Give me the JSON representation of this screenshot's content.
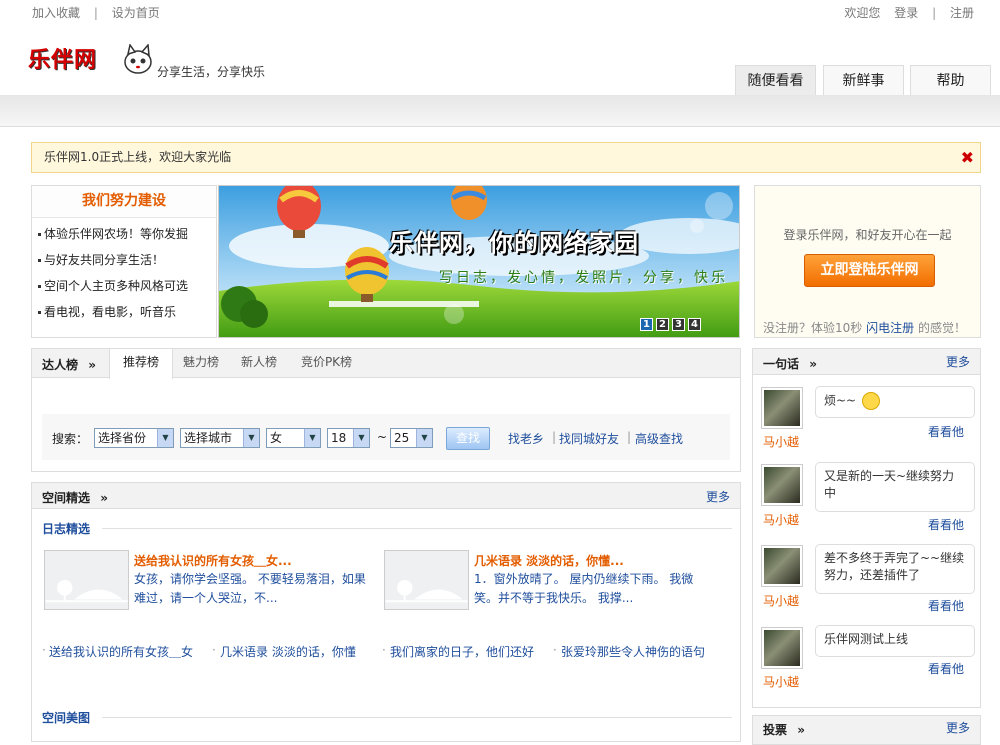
{
  "top": {
    "links": [
      "加入收藏",
      "设为首页"
    ],
    "sep": "|",
    "user_links": [
      "欢迎您",
      "登录",
      "注册"
    ]
  },
  "header": {
    "logo": "乐伴网",
    "slogan": "分享生活，分享快乐",
    "tabs": [
      "随便看看",
      "新鲜事",
      "帮助"
    ]
  },
  "notice": {
    "text": "乐伴网1.0正式上线，欢迎大家光临",
    "close": "✖"
  },
  "build": {
    "title": "我们努力建设",
    "items": [
      "体验乐伴网农场！等你发掘",
      "与好友共同分享生活！",
      "空间个人主页多种风格可选",
      "看电视，看电影，听音乐"
    ]
  },
  "banner": {
    "title": "乐伴网，你的网络家园",
    "subtitle": "写日志，发心情，发照片，分享，快乐",
    "pages": [
      "1",
      "2",
      "3",
      "4"
    ]
  },
  "login": {
    "text": "登录乐伴网，和好友开心在一起",
    "button": "立即登陆乐伴网",
    "reg_prefix": "没注册？体验10秒",
    "reg_link": "闪电注册",
    "reg_suffix": "的感觉！"
  },
  "rank": {
    "title": "达人榜",
    "arrow": "»",
    "tabs": [
      "推荐榜",
      "魅力榜",
      "新人榜",
      "竞价PK榜"
    ],
    "search_label": "搜索：",
    "province": "选择省份",
    "city": "选择城市",
    "gender": "女",
    "age_from": "18",
    "age_to": "25",
    "tilde": "~",
    "search_button": "查找",
    "quick_links": [
      "找老乡",
      "找同城好友",
      "高级查找"
    ]
  },
  "space": {
    "title": "空间精选",
    "arrow": "»",
    "more": "更多",
    "blog_title": "日志精选",
    "posts": [
      {
        "title": "送给我认识的所有女孩＿女...",
        "desc": "女孩，请你学会坚强。  不要轻易落泪，如果难过，请一个人哭泣，不..."
      },
      {
        "title": "几米语录  淡淡的话，你懂...",
        "desc": "1．窗外放晴了。  屋内仍继续下雨。  我微笑。并不等于我快乐。  我撑..."
      }
    ],
    "links": [
      "送给我认识的所有女孩＿女",
      "几米语录  淡淡的话，你懂",
      "我们离家的日子，他们还好",
      "张爱玲那些令人神伤的语句"
    ],
    "photo_title": "空间美图"
  },
  "yiju": {
    "title": "一句话",
    "arrow": "»",
    "more": "更多",
    "look": "看看他",
    "items": [
      {
        "user": "马小越",
        "text": "烦~~"
      },
      {
        "user": "马小越",
        "text": "又是新的一天~继续努力中"
      },
      {
        "user": "马小越",
        "text": "差不多终于弄完了~~继续努力，还差插件了"
      },
      {
        "user": "马小越",
        "text": "乐伴网测试上线"
      }
    ]
  },
  "vote": {
    "title": "投票",
    "arrow": "»",
    "more": "更多"
  }
}
